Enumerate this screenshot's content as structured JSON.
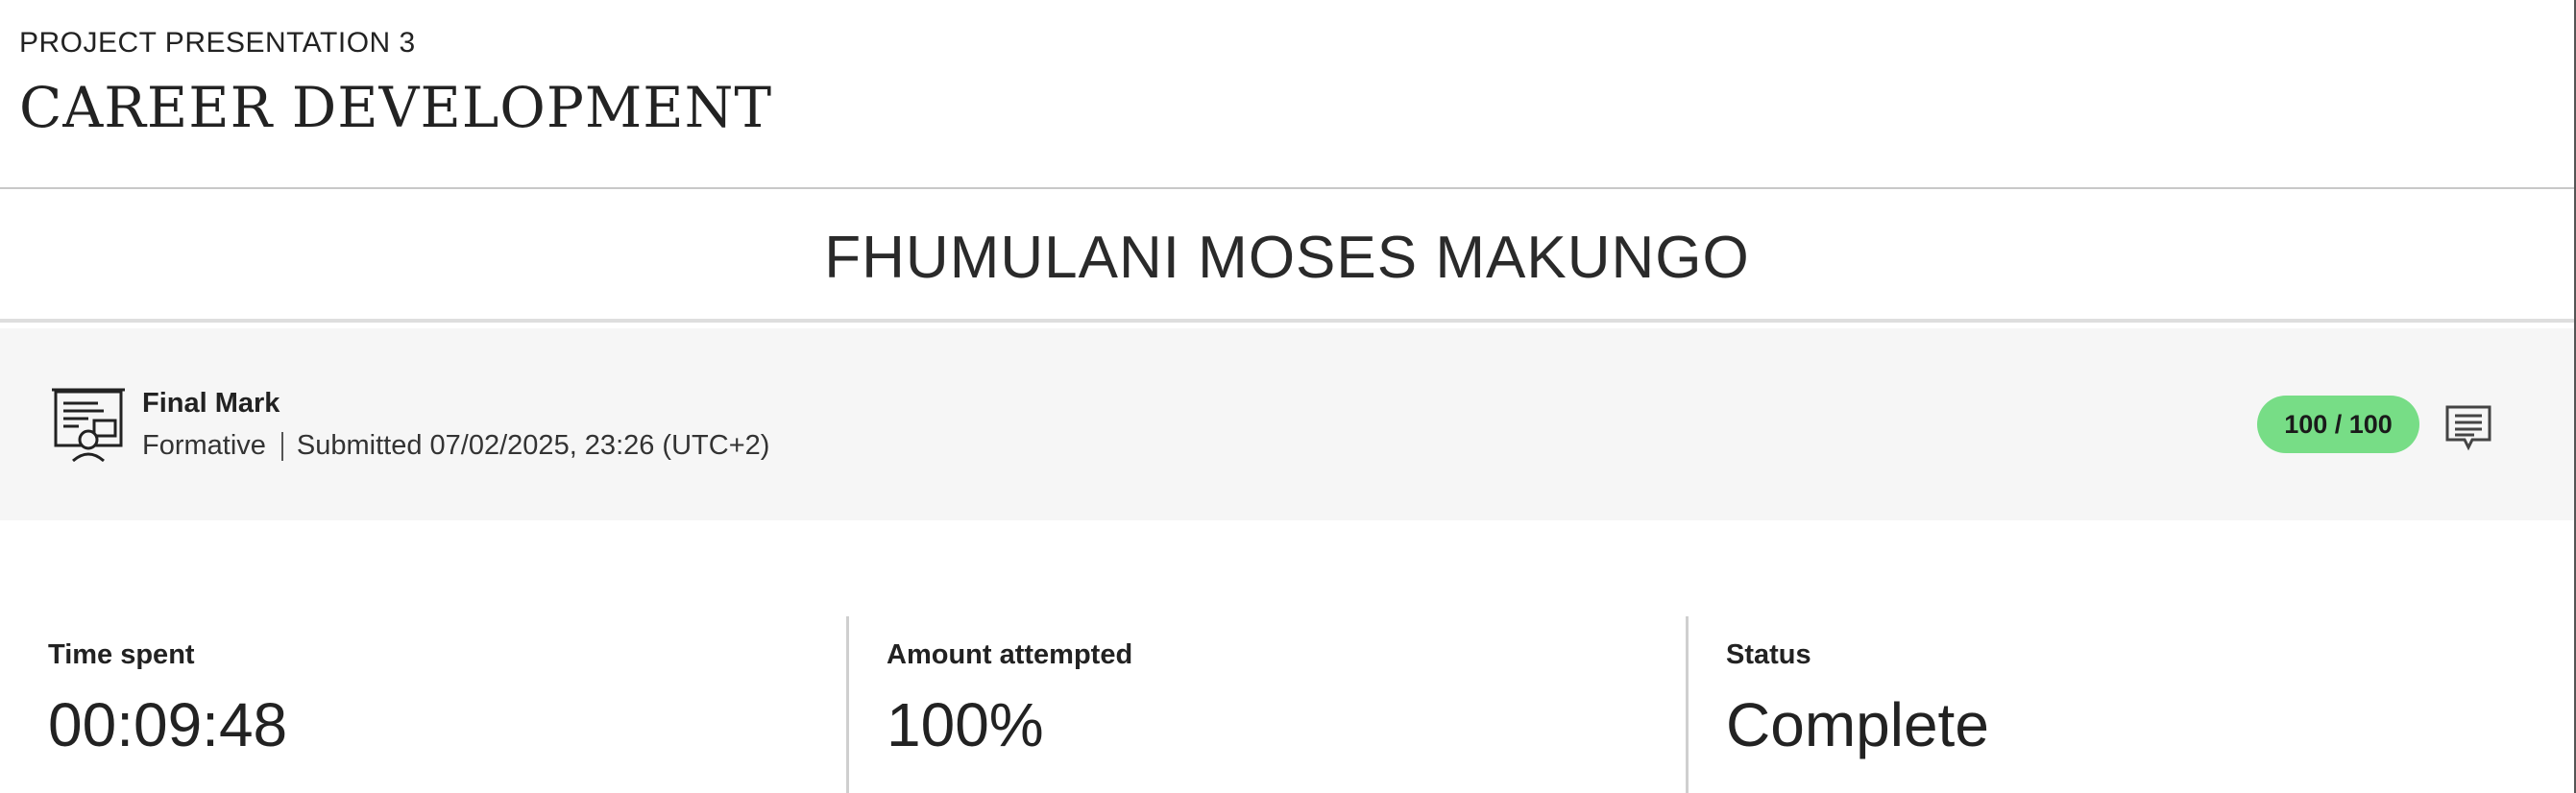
{
  "course": {
    "code": "PROJECT PRESENTATION 3",
    "title": "CAREER DEVELOPMENT"
  },
  "student": {
    "name": "FHUMULANI MOSES MAKUNGO"
  },
  "mark": {
    "label": "Final Mark",
    "type": "Formative",
    "submitted": "Submitted 07/02/2025, 23:26 (UTC+2)",
    "score": "100 / 100",
    "score_color": "#77dd86",
    "icon": "presentation-icon",
    "feedback_icon": "feedback-icon"
  },
  "stats": {
    "time_spent": {
      "label": "Time spent",
      "value": "00:09:48"
    },
    "amount_attempted": {
      "label": "Amount attempted",
      "value": "100%"
    },
    "status": {
      "label": "Status",
      "value": "Complete"
    }
  }
}
